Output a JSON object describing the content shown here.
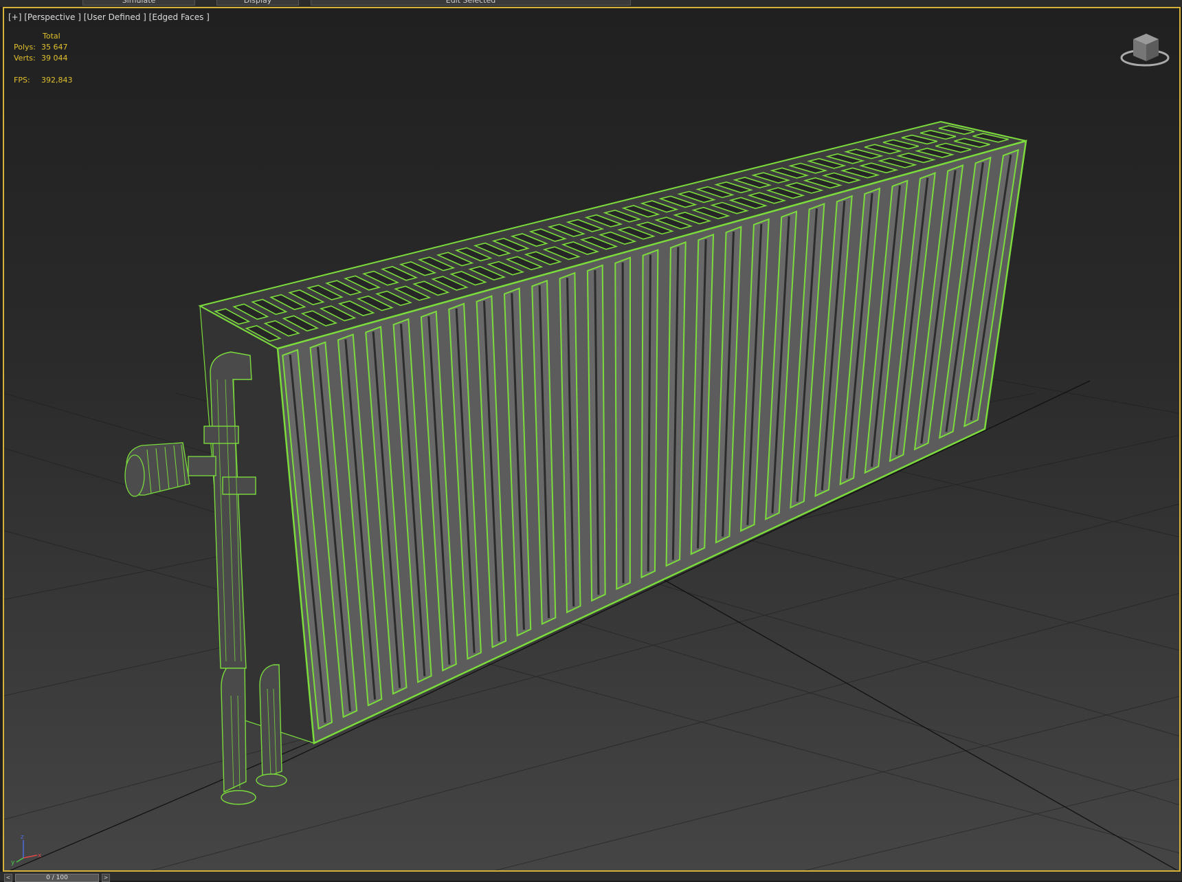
{
  "toolbar": {
    "tabs": [
      {
        "label": "Simulate"
      },
      {
        "label": "Display"
      },
      {
        "label": "Edit Selected"
      }
    ]
  },
  "viewport": {
    "label": "[+] [Perspective ] [User Defined ] [Edged Faces ]",
    "stats": {
      "header": "Total",
      "polys_label": "Polys:",
      "polys_value": "35 647",
      "verts_label": "Verts:",
      "verts_value": "39 044",
      "fps_label": "FPS:",
      "fps_value": "392,843"
    },
    "axis": {
      "x": "x",
      "y": "y",
      "z": "z"
    }
  },
  "timeline": {
    "value": "0 / 100",
    "prev_symbol": "<",
    "next_symbol": ">"
  },
  "colors": {
    "selection_green": "#7bdc3c",
    "viewport_border": "#d6b23a",
    "stats_text": "#e2c22e"
  },
  "icons": [
    "viewcube-icon",
    "axis-gizmo-icon"
  ]
}
